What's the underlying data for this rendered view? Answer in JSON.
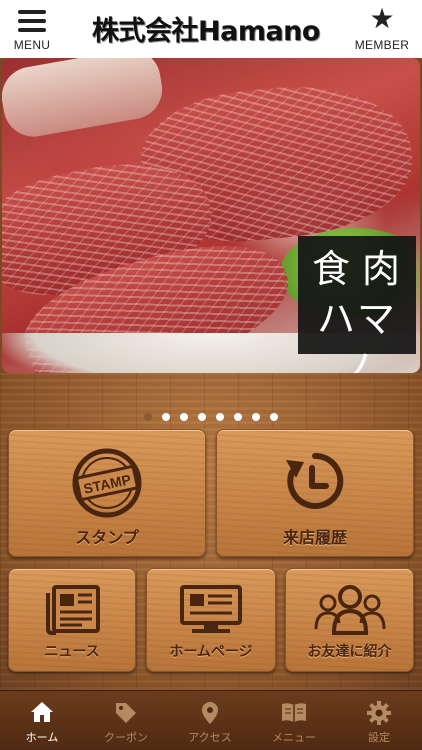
{
  "header": {
    "menu_label": "MENU",
    "title": "株式会社Hamano",
    "member_label": "MEMBER"
  },
  "hero": {
    "brand_line1": "食肉",
    "brand_line2": "ハマノ",
    "carousel_total": 8,
    "carousel_active_index": 0
  },
  "tiles": {
    "stamp_badge": "STAMP",
    "stamp": "スタンプ",
    "history": "来店履歴",
    "news": "ニュース",
    "homepage": "ホームページ",
    "friend": "お友達に紹介"
  },
  "tabs": [
    {
      "label": "ホーム",
      "icon": "home-icon",
      "active": true
    },
    {
      "label": "クーポン",
      "icon": "tag-icon",
      "active": false
    },
    {
      "label": "アクセス",
      "icon": "map-pin-icon",
      "active": false
    },
    {
      "label": "メニュー",
      "icon": "book-icon",
      "active": false
    },
    {
      "label": "設定",
      "icon": "gear-icon",
      "active": false
    }
  ],
  "colors": {
    "tab_active": "#ffffff",
    "tab_inactive": "#b48a62",
    "tile_text": "#4a2510"
  }
}
